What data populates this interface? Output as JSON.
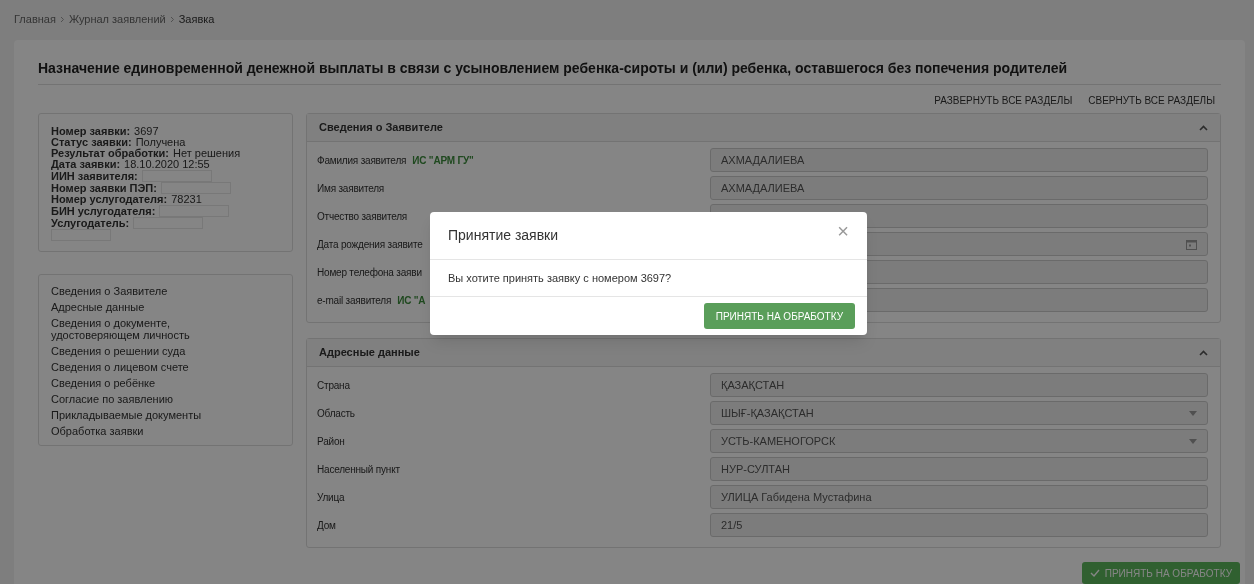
{
  "breadcrumb": [
    {
      "label": "Главная"
    },
    {
      "label": "Журнал заявлений"
    },
    {
      "label": "Заявка"
    }
  ],
  "title": "Назначение единовременной денежной выплаты в связи с усыновлением ребенка-сироты и (или) ребенка, оставшегося без попечения родителей",
  "actions": [
    "РАЗВЕРНУТЬ ВСЕ РАЗДЕЛЫ",
    "СВЕРНУТЬ ВСЕ РАЗДЕЛЫ"
  ],
  "info": [
    {
      "label": "Номер заявки:",
      "kind": "text",
      "value": "3697"
    },
    {
      "label": "Статус заявки:",
      "kind": "text",
      "value": "Получена"
    },
    {
      "label": "Результат обработки:",
      "kind": "text",
      "value": "Нет решения"
    },
    {
      "label": "Дата заявки:",
      "kind": "text",
      "value": "18.10.2020 12:55"
    },
    {
      "label": "ИИН заявителя:",
      "kind": "redacted"
    },
    {
      "label": "Номер заявки ПЭП:",
      "kind": "redacted"
    },
    {
      "label": "Номер услугодателя:",
      "kind": "text",
      "value": "78231"
    },
    {
      "label": "БИН услугодателя:",
      "kind": "redacted"
    },
    {
      "label": "Услугодатель:",
      "kind": "redacted_wrapped"
    }
  ],
  "nav": [
    "Сведения о Заявителе",
    "Адресные данные",
    "Сведения о документе, удостоверяющем личность",
    "Сведения о решении суда",
    "Сведения о лицевом счете",
    "Сведения о ребёнке",
    "Согласие по заявлению",
    "Прикладываемые документы",
    "Обработка заявки"
  ],
  "sections": [
    {
      "title": "Сведения о Заявителе",
      "expanded": true,
      "rows": [
        {
          "label": "Фамилия заявителя",
          "source": "ИС \"АРМ ГУ\"",
          "kind": "text",
          "value": "АХМАДАЛИЕВА"
        },
        {
          "label": "Имя заявителя",
          "kind": "text",
          "value": "АХМАДАЛИЕВА"
        },
        {
          "label": "Отчество заявителя",
          "kind": "text"
        },
        {
          "label": "Дата рождения заявите",
          "kind": "date"
        },
        {
          "label": "Номер телефона заяви",
          "kind": "text"
        },
        {
          "label": "e-mail заявителя",
          "source": "ИС \"А",
          "kind": "text"
        }
      ]
    },
    {
      "title": "Адресные данные",
      "expanded": true,
      "rows": [
        {
          "label": "Страна",
          "kind": "text",
          "value": "ҚАЗАҚСТАН"
        },
        {
          "label": "Область",
          "kind": "select",
          "value": "ШЫҒ-ҚАЗАҚСТАН"
        },
        {
          "label": "Район",
          "kind": "select",
          "value": "УСТЬ-КАМЕНОГОРСК"
        },
        {
          "label": "Населенный пункт",
          "kind": "text",
          "value": "НУР-СУЛТАН"
        },
        {
          "label": "Улица",
          "kind": "text",
          "value": "УЛИЦА Габидена Мустафина"
        },
        {
          "label": "Дом",
          "kind": "text",
          "value": "21/5"
        }
      ]
    }
  ],
  "footer_button": "ПРИНЯТЬ НА ОБРАБОТКУ",
  "modal": {
    "title": "Принятие заявки",
    "close": "×",
    "message": "Вы хотите принять заявку с номером 3697?",
    "button": "ПРИНЯТЬ НА ОБРАБОТКУ"
  }
}
